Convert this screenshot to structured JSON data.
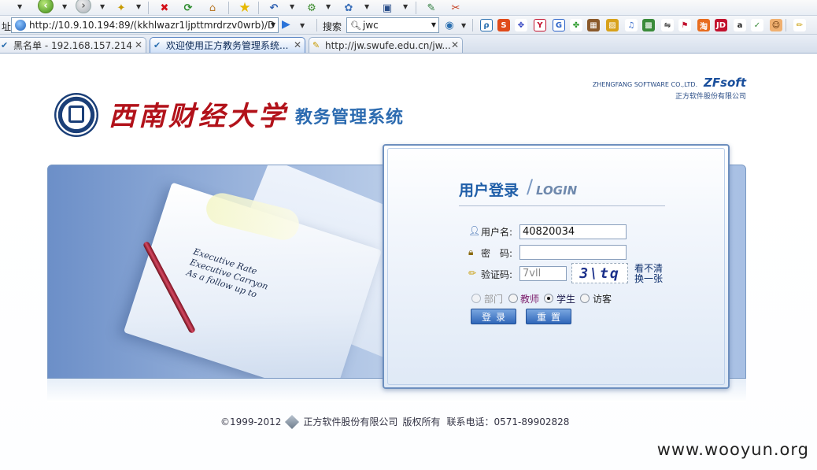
{
  "browser": {
    "address_label": "址",
    "url": "http://10.9.10.194:89/(kkhlwazr1ljpttmrdrzv0wrb)/D",
    "search_label": "搜索",
    "search_value": "jwc",
    "tabs": [
      {
        "label": "黑名单 - 192.168.157.214",
        "icon": "check-icon"
      },
      {
        "label": "欢迎使用正方教务管理系统...",
        "icon": "check-icon"
      },
      {
        "label": "http://jw.swufe.edu.cn/jw...",
        "icon": "page-icon"
      }
    ]
  },
  "header": {
    "vendor_en": "ZHENGFANG SOFTWARE CO.,LTD.",
    "vendor_logo": "ZFsoft",
    "vendor_cn": "正方软件股份有限公司",
    "university": "西南财经大学",
    "system": "教务管理系统"
  },
  "banner": {
    "text_lines": [
      "Executive Rate",
      "Executive Carryon",
      "As a follow up to"
    ]
  },
  "login": {
    "title": "用户登录",
    "title_en": "LOGIN",
    "username_label": "用户名:",
    "username_value": "40820034",
    "password_label": "密　码:",
    "password_value": "",
    "captcha_label": "验证码:",
    "captcha_value": "7vll",
    "captcha_image_text": "3\\tq",
    "captcha_refresh_1": "看不清",
    "captcha_refresh_2": "换一张",
    "roles": [
      {
        "label": "部门",
        "checked": false,
        "enabled": false
      },
      {
        "label": "教师",
        "checked": false,
        "enabled": true
      },
      {
        "label": "学生",
        "checked": true,
        "enabled": true
      },
      {
        "label": "访客",
        "checked": false,
        "enabled": true
      }
    ],
    "login_button": "登录",
    "reset_button": "重置"
  },
  "footer": {
    "copyright": "©1999-2012",
    "company": "正方软件股份有限公司",
    "rights": "版权所有",
    "phone": "联系电话：0571-89902828"
  },
  "watermark": "www.wooyun.org",
  "colors": {
    "brand_red": "#b2121a",
    "brand_blue": "#1f5ea8",
    "button_blue": "#2f66b9"
  }
}
